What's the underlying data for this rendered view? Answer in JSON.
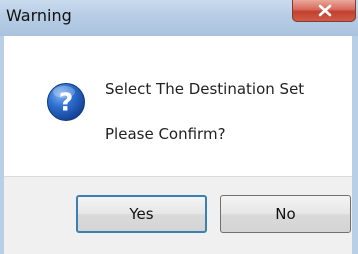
{
  "window": {
    "title": "Warning",
    "close_icon": "close-icon"
  },
  "message": {
    "icon": "question-icon",
    "line1": "Select The Destination Set",
    "line2": "Please Confirm?"
  },
  "buttons": {
    "yes_label": "Yes",
    "no_label": "No"
  },
  "colors": {
    "titlebar": "#b7cde5",
    "close_button": "#c2402e",
    "icon_blue": "#1f5fb5",
    "default_button_border": "#3c7fb1"
  }
}
